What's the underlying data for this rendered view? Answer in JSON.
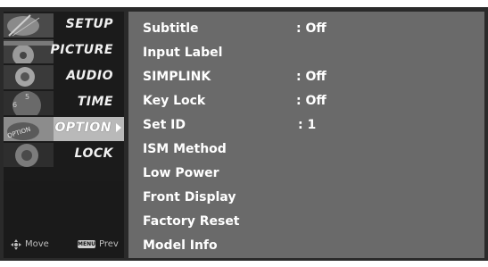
{
  "sidebar": {
    "items": [
      {
        "label": "SETUP"
      },
      {
        "label": "PICTURE"
      },
      {
        "label": "AUDIO"
      },
      {
        "label": "TIME"
      },
      {
        "label": "OPTION"
      },
      {
        "label": "LOCK"
      }
    ],
    "selected": "OPTION",
    "footer": {
      "move_label": "Move",
      "menu_key_label": "MENU",
      "prev_label": "Prev"
    }
  },
  "option_menu": {
    "items": [
      {
        "label": "Subtitle",
        "value": ": Off"
      },
      {
        "label": "Input Label",
        "value": ""
      },
      {
        "label": "SIMPLINK",
        "value": ": Off"
      },
      {
        "label": "Key Lock",
        "value": ": Off"
      },
      {
        "label": "Set ID",
        "value": ": 1"
      },
      {
        "label": "ISM Method",
        "value": ""
      },
      {
        "label": "Low Power",
        "value": ""
      },
      {
        "label": "Front Display",
        "value": ""
      },
      {
        "label": "Factory Reset",
        "value": ""
      },
      {
        "label": "Model Info",
        "value": ""
      }
    ]
  }
}
